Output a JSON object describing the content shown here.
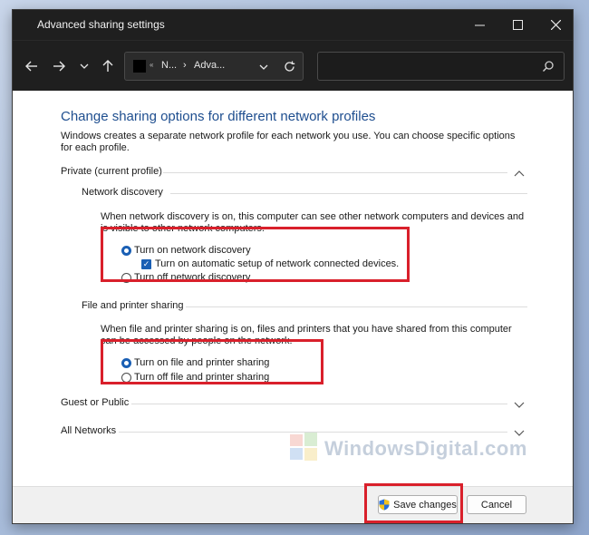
{
  "window": {
    "title": "Advanced sharing settings",
    "controls": {
      "minimize": "—",
      "maximize": "☐",
      "close": "✕"
    }
  },
  "toolbar": {
    "breadcrumb_small": "«",
    "breadcrumb_part1": "N...",
    "breadcrumb_sep": "›",
    "breadcrumb_part2": "Adva...",
    "search_placeholder": ""
  },
  "main": {
    "heading": "Change sharing options for different network profiles",
    "description": "Windows creates a separate network profile for each network you use. You can choose specific options for each profile.",
    "private_profile": {
      "label": "Private (current profile)",
      "network_discovery": {
        "label": "Network discovery",
        "description": "When network discovery is on, this computer can see other network computers and devices and is visible to other network computers.",
        "option_on": "Turn on network discovery",
        "auto_setup": "Turn on automatic setup of network connected devices.",
        "option_off": "Turn off network discovery",
        "selected": "on",
        "auto_setup_checked": true
      },
      "file_printer_sharing": {
        "label": "File and printer sharing",
        "description": "When file and printer sharing is on, files and printers that you have shared from this computer can be accessed by people on the network.",
        "option_on": "Turn on file and printer sharing",
        "option_off": "Turn off file and printer sharing",
        "selected": "on"
      }
    },
    "guest_public": {
      "label": "Guest or Public"
    },
    "all_networks": {
      "label": "All Networks"
    }
  },
  "footer": {
    "save_label": "Save changes",
    "cancel_label": "Cancel"
  },
  "watermark": {
    "text": "WindowsDigital.com"
  },
  "colors": {
    "accent": "#1a5fb4",
    "heading": "#1e4e8f",
    "highlight": "#d9202b",
    "titlebar": "#1f1f1f"
  }
}
